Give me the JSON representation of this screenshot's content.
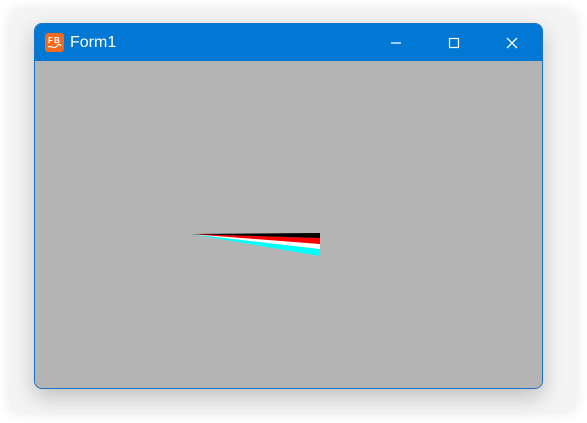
{
  "window": {
    "title": "Form1",
    "icon_name": "fb-app-icon",
    "controls": {
      "minimize": "minimize-icon",
      "maximize": "maximize-icon",
      "close": "close-icon"
    }
  },
  "colors": {
    "titlebar": "#0078d4",
    "client_background": "#b4b4b4",
    "app_icon": "#f36a1c",
    "wedge_colors": [
      "#000000",
      "#ff0000",
      "#ffffff",
      "#00ffff"
    ]
  }
}
